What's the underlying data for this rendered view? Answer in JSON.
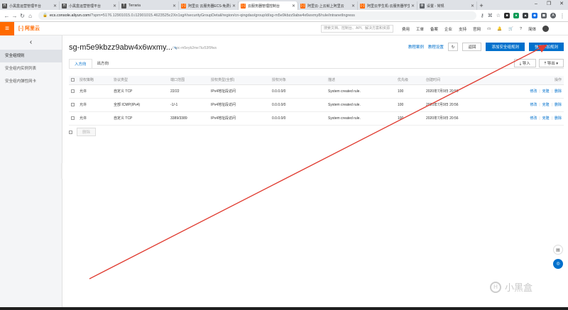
{
  "browser": {
    "tabs": [
      {
        "title": "小黑盒运营管理平台",
        "icon": "H",
        "icon_color": "#555555"
      },
      {
        "title": "小黑盒运营管理平台",
        "icon": "H",
        "icon_color": "#555555"
      },
      {
        "title": "Terraria",
        "icon": "T",
        "icon_color": "#777777"
      },
      {
        "title": "阿里云 云服务器ECS-免费试用",
        "icon": "[-]",
        "icon_color": "#ff6a00"
      },
      {
        "title": "云服务器管理控制台",
        "icon": "[-]",
        "icon_color": "#ff6a00",
        "active": true
      },
      {
        "title": "阿里云-上云就上阿里云",
        "icon": "[-]",
        "icon_color": "#ff6a00"
      },
      {
        "title": "阿里云学生机-云服务器学生",
        "icon": "[-]",
        "icon_color": "#ff6a00"
      },
      {
        "title": "设置 - 常规",
        "icon": "⚙",
        "icon_color": "#5f6368"
      }
    ],
    "url_prefix": "ecs.console.aliyun.com",
    "url_rest": "/?spm=5176.12901015.0.i12901015.4623525c2Xn1xg#/securityGroupDetail/region/cn-qingdao/groupId/sg-m5e9kbzz9abw4x6wxmy8/rule/intranetIngress"
  },
  "topnav": {
    "logo_text": "阿里云",
    "search_placeholder": "搜索文档、控制台、API、解决方案和资源",
    "links": [
      "费用",
      "工单",
      "备案",
      "企业",
      "支持",
      "官网"
    ],
    "lang": "简体"
  },
  "sidebar": {
    "items": [
      {
        "label": "安全组规则",
        "active": true
      },
      {
        "label": "安全组内实例列表"
      },
      {
        "label": "安全组内弹性网卡"
      }
    ]
  },
  "page": {
    "title": "sg-m5e9kbzz9abw4x6wxmy...",
    "subtitle": "/ vpc-m5eyb2me7kz53f9fws",
    "links": {
      "tutorial": "教程案例",
      "settings": "教程设置"
    },
    "buttons": {
      "back": "返回",
      "add_rule": "添加安全组规则",
      "quick_add": "快速添加规则",
      "import": "导入",
      "export": "导出"
    },
    "tabs": [
      "入方向",
      "出方向"
    ],
    "table_headers": [
      "授权策略",
      "协议类型",
      "端口范围",
      "授权类型(全部)",
      "授权对象",
      "描述",
      "优先级",
      "创建时间",
      "操作"
    ],
    "rows": [
      {
        "policy": "允许",
        "protocol": "自定义 TCP",
        "port": "22/22",
        "auth_type": "IPv4地址段访问",
        "object": "0.0.0.0/0",
        "desc": "System created rule.",
        "priority": "100",
        "created": "2020年7月9日 20:56"
      },
      {
        "policy": "允许",
        "protocol": "全部 ICMP(IPv4)",
        "port": "-1/-1",
        "auth_type": "IPv4地址段访问",
        "object": "0.0.0.0/0",
        "desc": "System created rule.",
        "priority": "100",
        "created": "2020年7月9日 20:56"
      },
      {
        "policy": "允许",
        "protocol": "自定义 TCP",
        "port": "3389/3389",
        "auth_type": "IPv4地址段访问",
        "object": "0.0.0.0/0",
        "desc": "System created rule.",
        "priority": "100",
        "created": "2020年7月9日 20:56"
      }
    ],
    "ops": {
      "edit": "修改",
      "clone": "克隆",
      "delete": "删除"
    },
    "bulk_delete": "删除"
  },
  "watermark": "小黑盒",
  "colors": {
    "accent": "#0070cc",
    "brand": "#ff6a00",
    "arrow": "#e03c31"
  }
}
